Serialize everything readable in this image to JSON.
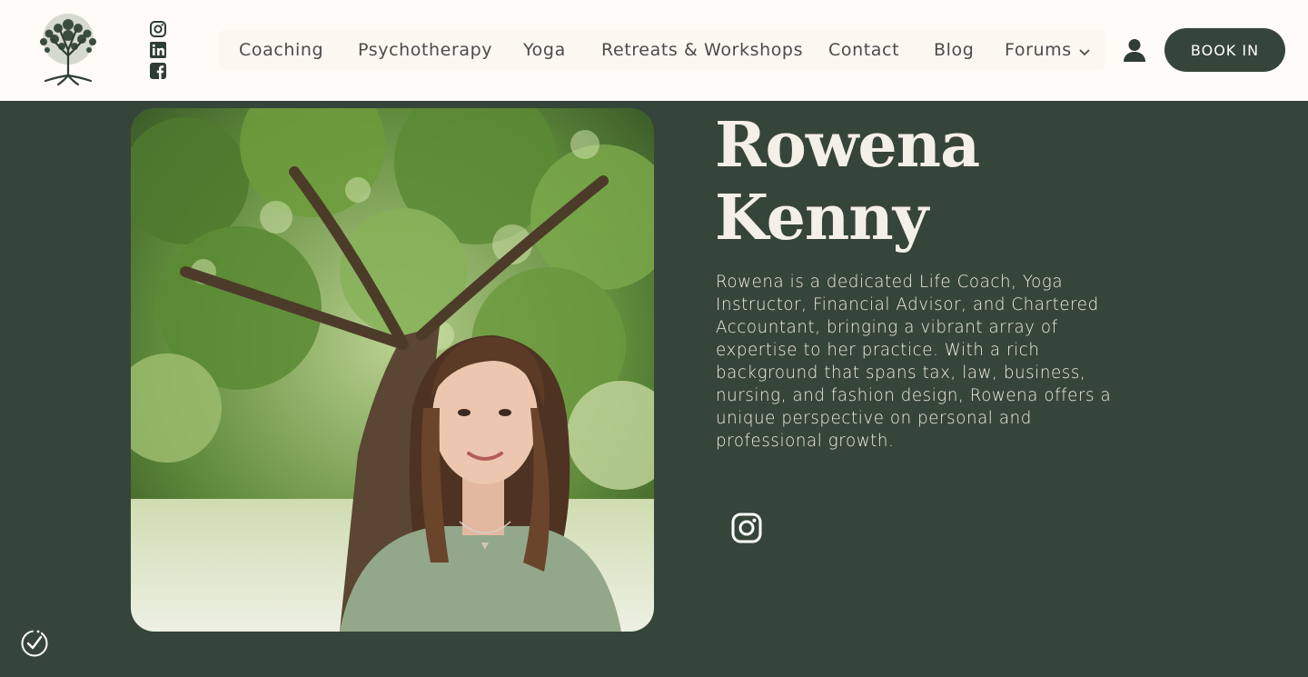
{
  "header": {
    "logo": {
      "name": "tree-logo-icon"
    },
    "social": [
      {
        "name": "instagram-icon"
      },
      {
        "name": "linkedin-icon"
      },
      {
        "name": "facebook-icon"
      }
    ],
    "nav": [
      {
        "label": "Coaching"
      },
      {
        "label": "Psychotherapy"
      },
      {
        "label": "Yoga"
      },
      {
        "label": "Retreats & Workshops"
      },
      {
        "label": "Contact"
      },
      {
        "label": "Blog"
      },
      {
        "label": "Forums"
      }
    ],
    "account_icon": "user-icon",
    "book_label": "BOOK IN"
  },
  "profile": {
    "name_line1": "Rowena",
    "name_line2": "Kenny",
    "bio": "Rowena is a dedicated Life Coach, Yoga Instructor, Financial Advisor, and Chartered Accountant, bringing a vibrant array of expertise to her practice. With a rich background that spans tax, law, business, nursing, and fashion design, Rowena offers a unique perspective on personal and professional growth.",
    "social_icon": "instagram-icon"
  },
  "colors": {
    "header_bg": "#fffbf6",
    "page_bg": "#364539",
    "button_bg": "#364539",
    "text_light": "#f4efe7",
    "nav_text": "#4b4b4b"
  },
  "accessibility_icon": "accessibility-icon"
}
